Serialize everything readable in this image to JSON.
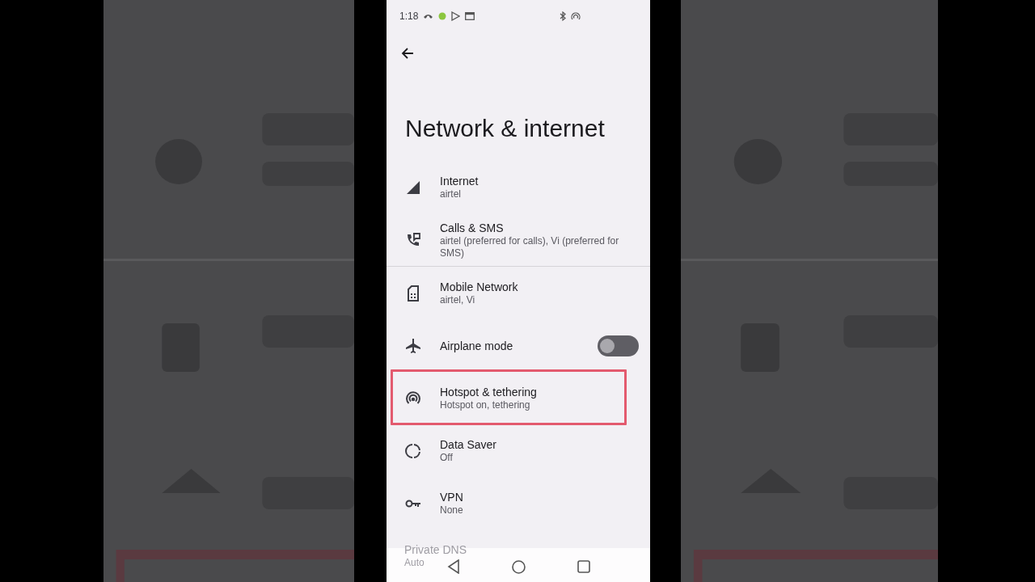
{
  "status_bar": {
    "time": "1:18"
  },
  "title": "Network & internet",
  "groups": [
    [
      {
        "kind": "link",
        "title": "Internet",
        "subtitle": "airtel",
        "highlighted": false
      },
      {
        "kind": "link",
        "title": "Calls & SMS",
        "subtitle": "airtel (preferred for calls), Vi (preferred for SMS)",
        "highlighted": false
      }
    ],
    [
      {
        "kind": "link",
        "title": "Mobile Network",
        "subtitle": "airtel, Vi",
        "highlighted": false
      },
      {
        "kind": "toggle",
        "title": "Airplane mode",
        "on": false,
        "highlighted": false
      },
      {
        "kind": "link",
        "title": "Hotspot & tethering",
        "subtitle": "Hotspot on, tethering",
        "highlighted": true
      },
      {
        "kind": "link",
        "title": "Data Saver",
        "subtitle": "Off",
        "highlighted": false
      },
      {
        "kind": "link",
        "title": "VPN",
        "subtitle": "None",
        "highlighted": false
      },
      {
        "kind": "faded",
        "title": "Private DNS",
        "subtitle": "Auto",
        "highlighted": false
      }
    ]
  ]
}
